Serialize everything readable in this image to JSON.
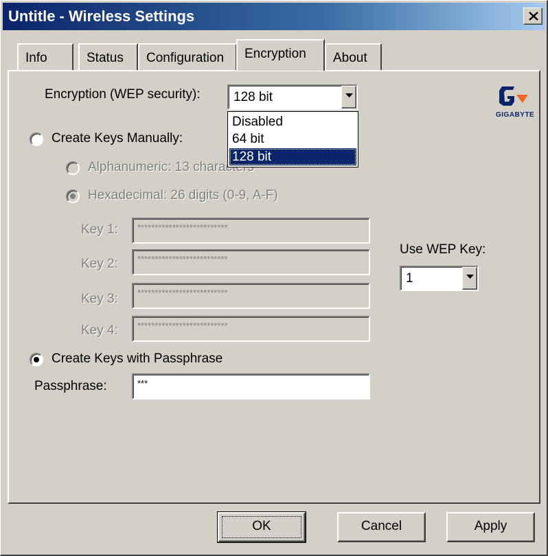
{
  "window": {
    "title": "Untitle - Wireless Settings",
    "close_label": "×"
  },
  "tabs": [
    {
      "label": "Info"
    },
    {
      "label": "Status"
    },
    {
      "label": "Configuration"
    },
    {
      "label": "Encryption",
      "active": true
    },
    {
      "label": "About"
    }
  ],
  "encryption": {
    "label": "Encryption (WEP security):",
    "selected": "128 bit",
    "options": [
      "Disabled",
      "64 bit",
      "128 bit"
    ]
  },
  "logo": {
    "text": "GIGABYTE"
  },
  "manual": {
    "label": "Create Keys Manually:",
    "checked": false,
    "alphanumeric_label": "Alphanumeric: 13 characters",
    "hex_label": "Hexadecimal: 26 digits (0-9, A-F)",
    "keys": [
      {
        "label": "Key 1:",
        "value": "**************************"
      },
      {
        "label": "Key 2:",
        "value": "**************************"
      },
      {
        "label": "Key 3:",
        "value": "**************************"
      },
      {
        "label": "Key 4:",
        "value": "**************************"
      }
    ]
  },
  "wep_key": {
    "label": "Use WEP Key:",
    "selected": "1"
  },
  "passphrase": {
    "radio_label": "Create Keys with Passphrase",
    "checked": true,
    "field_label": "Passphrase:",
    "value": "***"
  },
  "buttons": {
    "ok": "OK",
    "cancel": "Cancel",
    "apply": "Apply"
  },
  "colors": {
    "title_start": "#0a246a",
    "title_end": "#a6caf0",
    "selection": "#0a246a",
    "face": "#d4d0c8",
    "logo_orange": "#f26522"
  }
}
